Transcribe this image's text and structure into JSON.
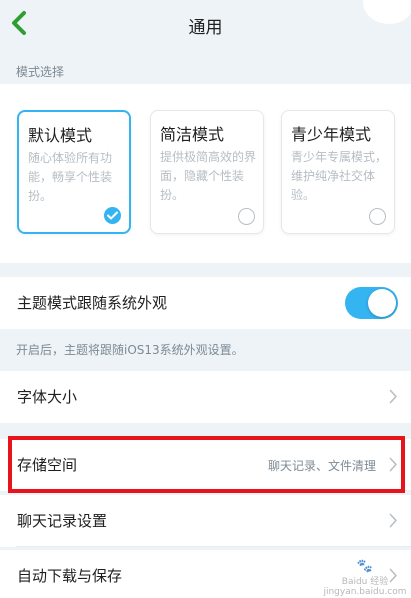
{
  "header": {
    "title": "通用",
    "back_icon": "chevron-left-icon"
  },
  "section": {
    "label": "模式选择"
  },
  "modes": [
    {
      "title": "默认模式",
      "desc": "随心体验所有功能，畅享个性装扮。",
      "selected": true
    },
    {
      "title": "简洁模式",
      "desc": "提供极简高效的界面，隐藏个性装扮。",
      "selected": false
    },
    {
      "title": "青少年模式",
      "desc": "青少年专属模式，维护纯净社交体验。",
      "selected": false
    }
  ],
  "follow_system": {
    "label": "主题模式跟随系统外观",
    "enabled": true
  },
  "hint": "开启后，主题将跟随iOS13系统外观设置。",
  "settings": {
    "font_size": {
      "label": "字体大小"
    },
    "storage": {
      "label": "存储空间",
      "value": "聊天记录、文件清理"
    },
    "chat_history": {
      "label": "聊天记录设置"
    },
    "auto_download": {
      "label": "自动下载与保存"
    }
  },
  "colors": {
    "accent": "#35b4f2",
    "highlight": "#e8141b",
    "back_arrow": "#2e9e33"
  },
  "watermark": {
    "line1": "Baidu 经验",
    "line2": "jingyan.baidu.com"
  }
}
